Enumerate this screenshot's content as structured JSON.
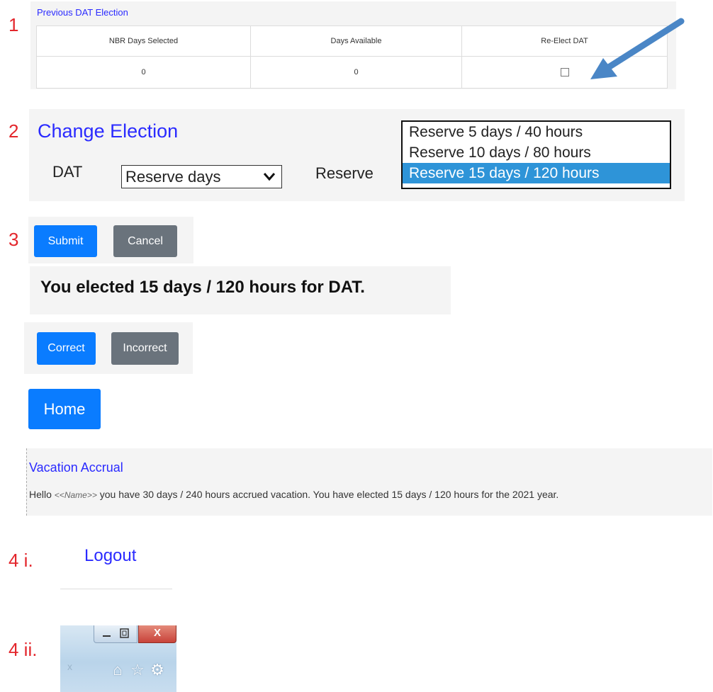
{
  "steps": {
    "s1": "1",
    "s2": "2",
    "s3": "3",
    "s4i": "4 i.",
    "s4ii": "4 ii."
  },
  "previous_election": {
    "title": "Previous DAT Election",
    "headers": [
      "NBR Days Selected",
      "Days Available",
      "Re-Elect DAT"
    ],
    "row": {
      "nbr_days": "0",
      "days_available": "0",
      "re_elect_checked": false
    }
  },
  "change_election": {
    "title": "Change Election",
    "dat_label": "DAT",
    "dat_select_value": "Reserve days",
    "reserve_label": "Reserve",
    "reserve_options": [
      "Reserve 5 days / 40 hours",
      "Reserve 10 days / 80 hours",
      "Reserve 15 days / 120 hours"
    ],
    "reserve_selected_index": 2
  },
  "actions": {
    "submit": "Submit",
    "cancel": "Cancel"
  },
  "confirmation": {
    "message": "You elected 15 days / 120 hours for DAT.",
    "correct": "Correct",
    "incorrect": "Incorrect"
  },
  "home": "Home",
  "vacation": {
    "title": "Vacation Accrual",
    "hello": "Hello",
    "name_placeholder": "<<Name>>",
    "text": "you have 30 days / 240 hours accrued vacation. You have elected 15 days / 120 hours for the 2021 year."
  },
  "logout": "Logout",
  "window_chrome": {
    "close": "X"
  },
  "colors": {
    "link_blue": "#2a2aff",
    "step_red": "#e3262c",
    "primary": "#0a7cff",
    "secondary": "#6a737c",
    "selected_option": "#2e94d8",
    "arrow": "#4a86c6"
  },
  "icons": [
    "arrow-annotation-icon",
    "checkbox-icon",
    "chevron-down-icon",
    "minimize-icon",
    "restore-icon",
    "close-icon",
    "home-icon",
    "star-icon",
    "gear-icon"
  ]
}
